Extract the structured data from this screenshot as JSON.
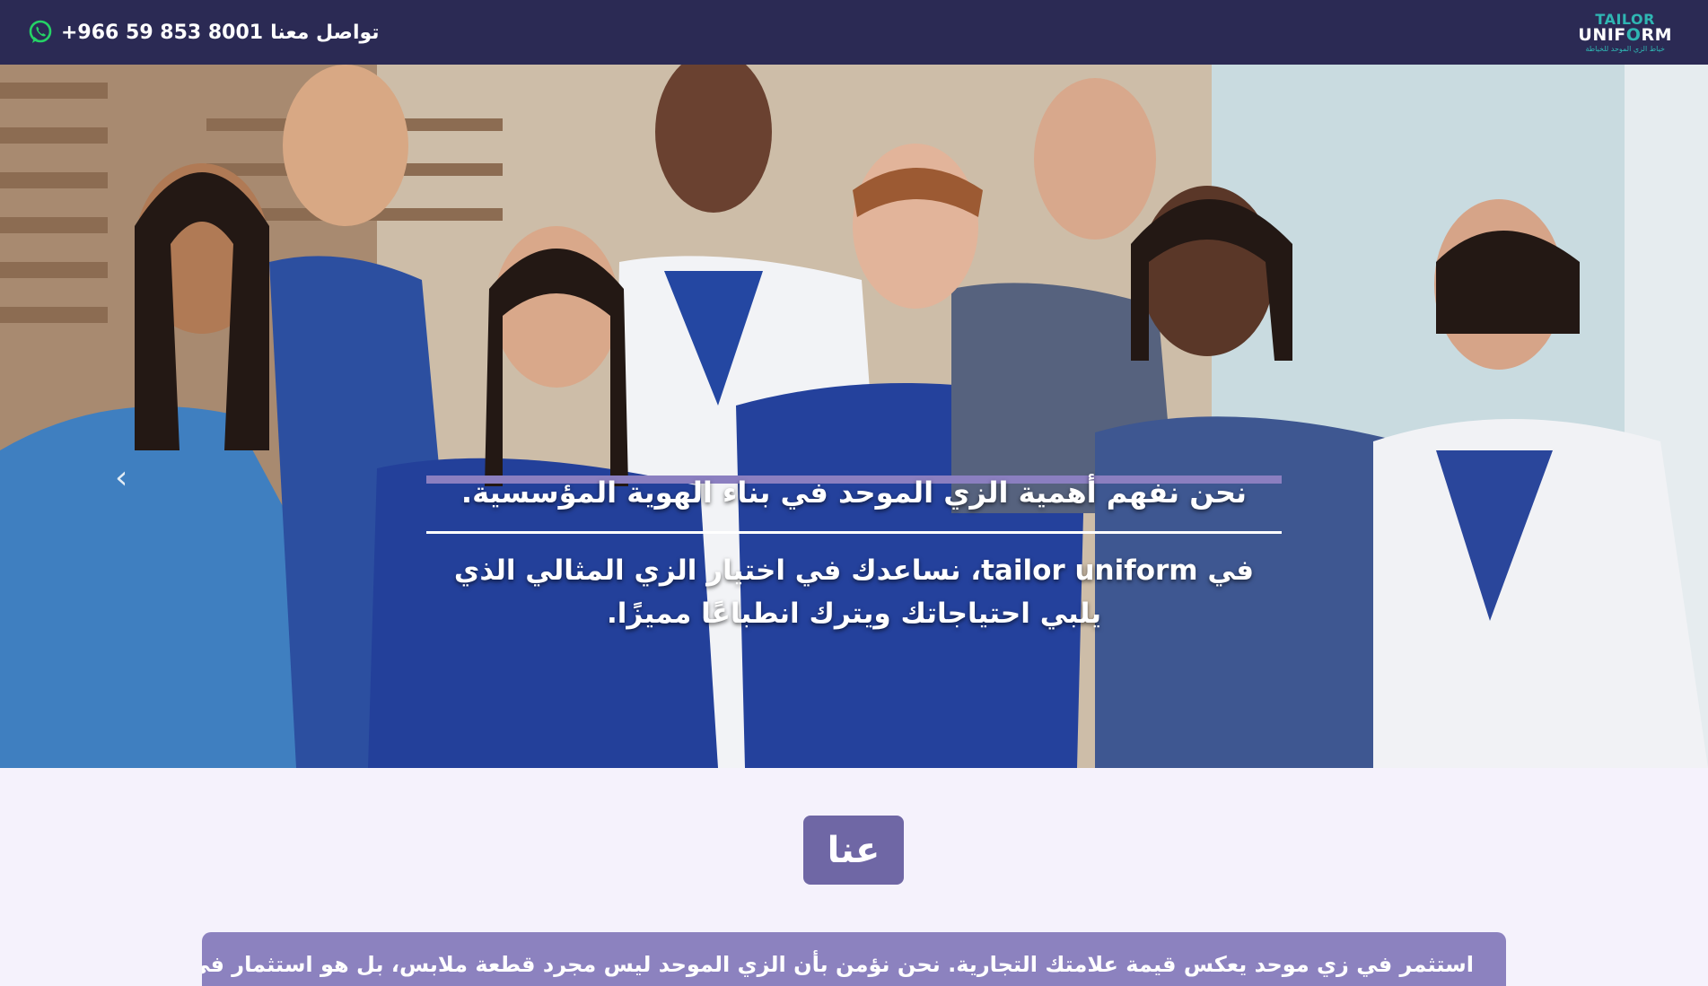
{
  "topbar": {
    "contact_label": "تواصل معنا",
    "phone": "+966 59 853 8001",
    "whatsapp_icon": "whatsapp-icon",
    "bg_color": "#2b2a54"
  },
  "logo": {
    "line1": "TAILOR",
    "line2_part1": "UNIF",
    "line2_o": "O",
    "line2_part2": "RM",
    "tagline": "خياط الزي الموحد للخياطة"
  },
  "hero": {
    "heading": "نحن نفهم أهمية الزي الموحد في بناء الهوية المؤسسية.",
    "subtext": "في tailor uniform، نساعدك في اختيار الزي المثالي الذي يلبي احتياجاتك ويترك انطباعًا مميزًا.",
    "prev_arrow": "‹",
    "accent_color": "#8b7fc0"
  },
  "about": {
    "badge_label": "عنا",
    "intro_text": "استثمر في زي موحد يعكس قيمة علامتك التجارية. نحن نؤمن بأن الزي الموحد ليس مجرد قطعة ملابس، بل هو استثمار في صورة شركتك. لهذا"
  }
}
